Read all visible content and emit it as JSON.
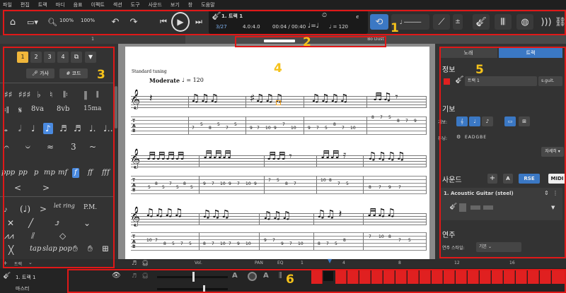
{
  "menubar": [
    "파일",
    "편집",
    "트랙",
    "마디",
    "음표",
    "이펙트",
    "섹션",
    "도구",
    "사운드",
    "보기",
    "창",
    "도움말"
  ],
  "toolbar": {
    "zoom": "100%",
    "zoom2": "100%",
    "track_name": "1. 트랙 1",
    "bar_position": "3/27",
    "time_signature": "4.0:4.0",
    "time": "00:04 / 00:40",
    "triplet_feel": "♩=♩",
    "tempo": "♩ = 120",
    "loop_icon": "loop-icon"
  },
  "trackbar": {
    "left": "1",
    "right": "Bo Dust"
  },
  "palette": {
    "voices": [
      "1",
      "2",
      "3",
      "4"
    ],
    "lyrics_btn": "가사",
    "chord_btn": "코드",
    "rows": [
      [
        "♯♯",
        "♯♯♯",
        "♭",
        "♮",
        "𝄆"
      ],
      [
        "𝄇",
        "𝄋",
        "8va",
        "8vb",
        "15ma"
      ],
      [
        "𝅗𝅥",
        "♩",
        "♪",
        "♬",
        "♬"
      ],
      [
        "𝄐",
        "𝄑",
        "≈",
        "3",
        "~"
      ],
      [
        "ppp",
        "pp",
        "p",
        "mp",
        "mf",
        "f",
        "ff",
        "fff"
      ]
    ],
    "effect_labels": [
      "let ring",
      "P.M.",
      "tap",
      "slap",
      "pop"
    ]
  },
  "score": {
    "annotation_text": "Standard tuning",
    "tempo_marking": "Moderate",
    "tempo_value": "♩ = 120",
    "tab_label": [
      "T",
      "A",
      "B"
    ],
    "system1_tab": [
      "10",
      "7",
      "5",
      "8",
      "5",
      "7",
      "5",
      "8",
      "5",
      "9",
      "7",
      "10",
      "9",
      "7",
      "10",
      "9",
      "7",
      "5",
      "8",
      "7",
      "10",
      "8",
      "7",
      "5",
      "8",
      "7",
      "9"
    ],
    "system2_tab": [
      "5",
      "8",
      "5",
      "7",
      "5",
      "8",
      "5",
      "7",
      "9",
      "7",
      "10",
      "9",
      "7",
      "10",
      "9",
      "7",
      "5",
      "8",
      "7",
      "10",
      "8",
      "7",
      "5",
      "8",
      "7",
      "9",
      "7"
    ],
    "system3_tab": [
      "10",
      "7",
      "8",
      "5",
      "7",
      "5",
      "8",
      "7",
      "10",
      "7",
      "9",
      "10",
      "9",
      "7",
      "9",
      "7",
      "10",
      "8",
      "7",
      "5",
      "8",
      "7",
      "10",
      "8",
      "7",
      "5"
    ]
  },
  "rpanel": {
    "tab_song": "노래",
    "tab_track": "트랙",
    "info_title": "정보",
    "track_name_value": "트랙 1",
    "track_short": "s.guit.",
    "notation_title": "기보",
    "tuning_label": "튜닝:",
    "tuning_value": "EADGBE",
    "notation_btn": "자세히",
    "sound_title": "사운드",
    "rse_btn": "RSE",
    "midi_btn": "MIDI",
    "instrument": "1. Acoustic Guitar (steel)",
    "play_title": "연주",
    "play_style_label": "연주 스타일:",
    "play_style_value": "기본"
  },
  "bottom": {
    "track_label": "트랙",
    "vol": "Vol.",
    "pan": "PAN",
    "eq": "EQ",
    "measures": [
      "1",
      "4",
      "8",
      "12",
      "16"
    ],
    "track1": "1. 트랙 1",
    "master": "마스터"
  },
  "annotations": [
    "1",
    "2",
    "3",
    "4",
    "5",
    "6"
  ],
  "colors": {
    "accent": "#3b78c4",
    "annotation_red": "#e01818",
    "annotation_yellow": "#f5c21a",
    "voice_active": "#f0b63a"
  }
}
